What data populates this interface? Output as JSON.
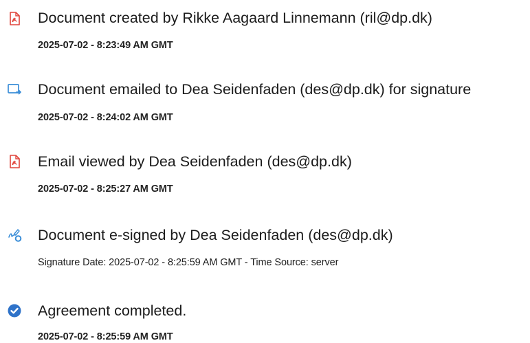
{
  "events": [
    {
      "icon": "pdf-document-icon",
      "title": "Document created by Rikke Aagaard Linnemann (ril@dp.dk)",
      "detail": "2025-07-02 - 8:23:49 AM GMT"
    },
    {
      "icon": "email-sent-icon",
      "title": "Document emailed to Dea Seidenfaden (des@dp.dk) for signature",
      "detail": "2025-07-02 - 8:24:02 AM GMT"
    },
    {
      "icon": "pdf-document-icon",
      "title": "Email viewed by Dea Seidenfaden (des@dp.dk)",
      "detail": "2025-07-02 - 8:25:27 AM GMT"
    },
    {
      "icon": "e-sign-pen-icon",
      "title": "Document e-signed by Dea Seidenfaden (des@dp.dk)",
      "detail": "Signature Date: 2025-07-02 - 8:25:59 AM GMT - Time Source: server"
    },
    {
      "icon": "check-circle-icon",
      "title": "Agreement completed.",
      "detail": "2025-07-02 - 8:25:59 AM GMT"
    }
  ],
  "colors": {
    "pdf_red": "#e0443b",
    "email_blue": "#3b8ed8",
    "check_blue": "#2f73c9",
    "text": "#1b1b1b"
  }
}
